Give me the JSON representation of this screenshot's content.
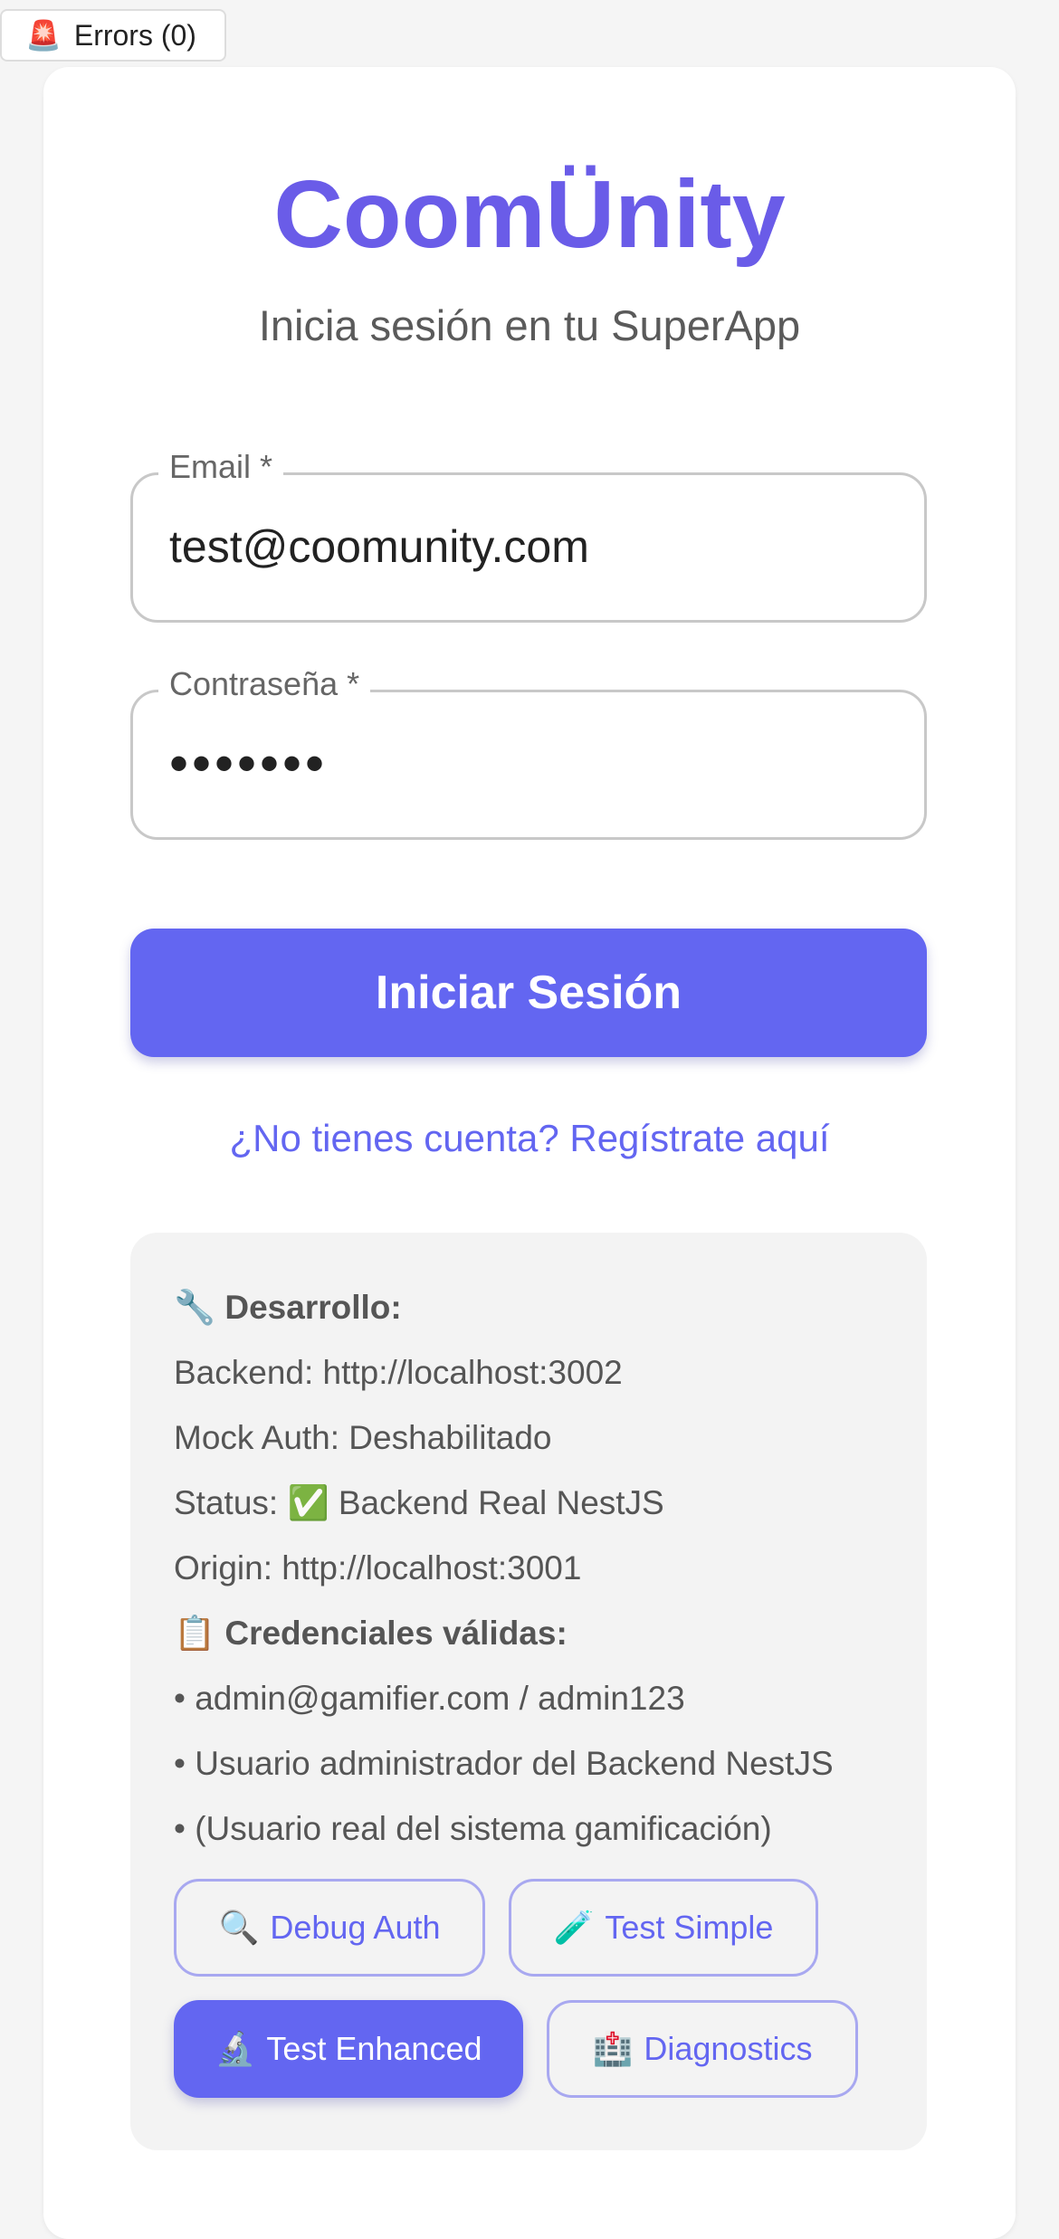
{
  "errors_badge": {
    "icon": "🚨",
    "label": "Errors (0)"
  },
  "brand": "CoomÜnity",
  "subtitle": "Inicia sesión en tu SuperApp",
  "form": {
    "email": {
      "label": "Email *",
      "value": "test@coomunity.com"
    },
    "password": {
      "label": "Contraseña *",
      "value": "•••••••"
    },
    "submit_label": "Iniciar Sesión",
    "register_link": "¿No tienes cuenta? Regístrate aquí"
  },
  "dev_panel": {
    "heading_icon": "🔧",
    "heading": "Desarrollo:",
    "backend": "Backend: http://localhost:3002",
    "mock_auth": "Mock Auth: Deshabilitado",
    "status_prefix": "Status:",
    "status_icon": "✅",
    "status_text": "Backend Real NestJS",
    "origin": "Origin: http://localhost:3001",
    "credentials_icon": "📋",
    "credentials_heading": "Credenciales válidas:",
    "credentials": [
      "• admin@gamifier.com / admin123",
      "• Usuario administrador del Backend NestJS",
      "• (Usuario real del sistema gamificación)"
    ],
    "buttons": [
      {
        "icon": "🔍",
        "label": "Debug Auth"
      },
      {
        "icon": "🧪",
        "label": "Test Simple"
      },
      {
        "icon": "🔬",
        "label": "Test Enhanced"
      },
      {
        "icon": "🏥",
        "label": "Diagnostics"
      }
    ]
  },
  "colors": {
    "accent": "#6366f1",
    "brand": "#6a5ce8",
    "panel_bg": "#f3f3f3"
  }
}
